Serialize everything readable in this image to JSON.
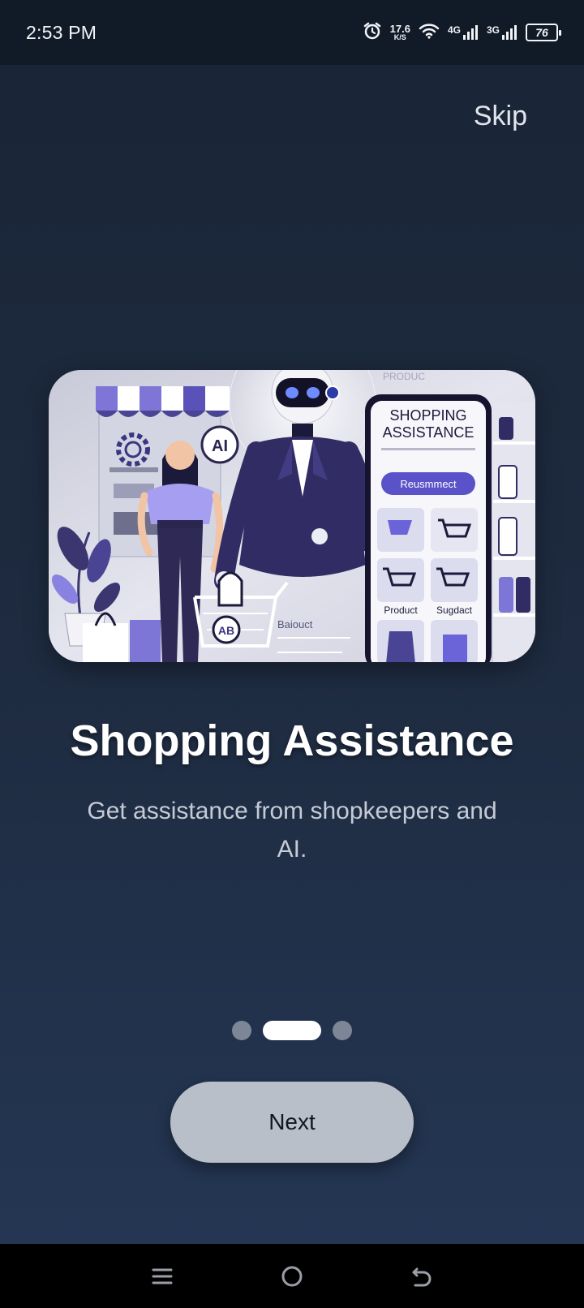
{
  "status_bar": {
    "time": "2:53 PM",
    "net_speed_value": "17.6",
    "net_speed_unit": "K/S",
    "network_1": "4G",
    "network_2": "3G",
    "battery": "76"
  },
  "onboarding": {
    "skip_label": "Skip",
    "title": "Shopping Assistance",
    "subtitle": "Get assistance from shopkeepers and AI.",
    "next_label": "Next",
    "page_count": 3,
    "active_page": 2
  },
  "hero_image": {
    "phone_title_line1": "SHOPPING",
    "phone_title_line2": "ASSISTANCE",
    "phone_button": "Reusmmect",
    "phone_label_1": "Product",
    "phone_label_2": "Sugdact",
    "ai_badge": "AI",
    "cart_badge": "AB",
    "top_label": "PRODUC",
    "bottom_label": "Baiouct"
  },
  "colors": {
    "background_top": "#1a2537",
    "background_bottom": "#243653",
    "accent_purple": "#6b63d8",
    "button_bg": "#b9bfc9"
  }
}
